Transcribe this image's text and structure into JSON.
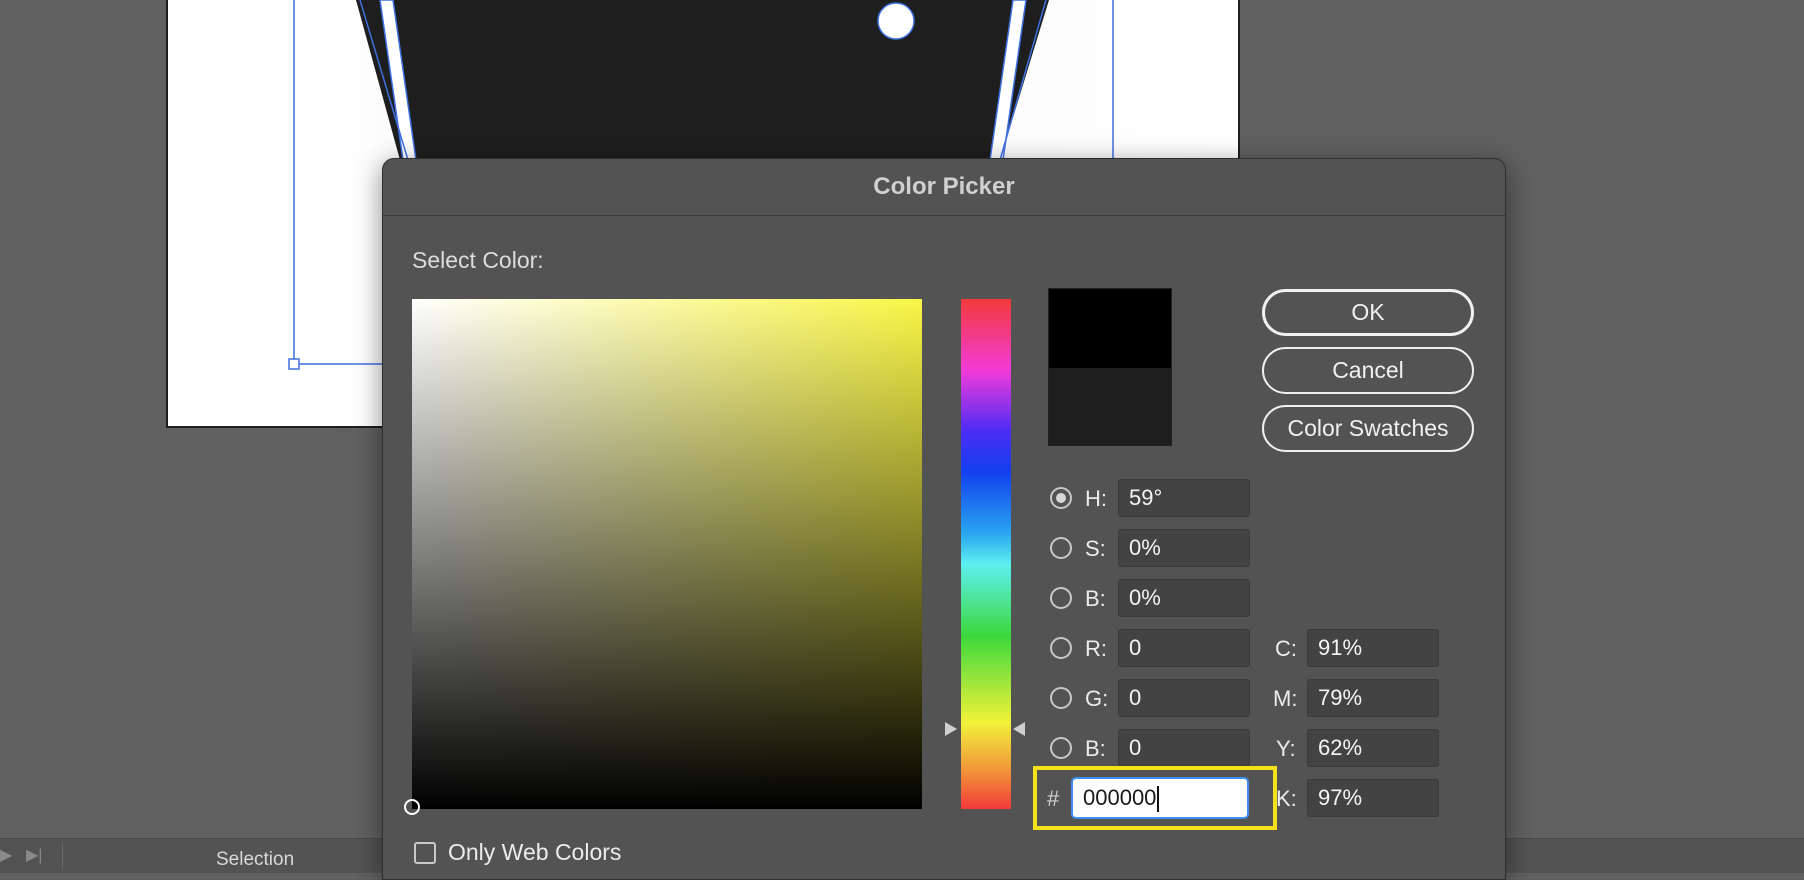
{
  "dialog": {
    "title": "Color Picker",
    "select_label": "Select Color:",
    "buttons": {
      "ok": "OK",
      "cancel": "Cancel",
      "swatches": "Color Swatches"
    },
    "swatch": {
      "new_color": "#000000",
      "old_color": "#1e1e1e"
    },
    "hsb": [
      {
        "label": "H:",
        "value": "59°",
        "checked": true
      },
      {
        "label": "S:",
        "value": "0%",
        "checked": false
      },
      {
        "label": "B:",
        "value": "0%",
        "checked": false
      }
    ],
    "rgb": [
      {
        "label": "R:",
        "value": "0"
      },
      {
        "label": "G:",
        "value": "0"
      },
      {
        "label": "B:",
        "value": "0"
      }
    ],
    "cmyk": [
      {
        "label": "C:",
        "value": "91%"
      },
      {
        "label": "M:",
        "value": "79%"
      },
      {
        "label": "Y:",
        "value": "62%"
      },
      {
        "label": "K:",
        "value": "97%"
      }
    ],
    "hex": {
      "prefix": "#",
      "value": "000000",
      "highlight_color": "#f4e11a"
    },
    "only_web_colors": {
      "label": "Only Web Colors",
      "checked": false
    }
  },
  "statusbar": {
    "tool": "Selection",
    "play_icon": "play-icon",
    "skip_icon": "skip-end-icon"
  },
  "canvas": {
    "shape_fill": "#1e1e1e",
    "guide_color": "#3f6fe0"
  }
}
